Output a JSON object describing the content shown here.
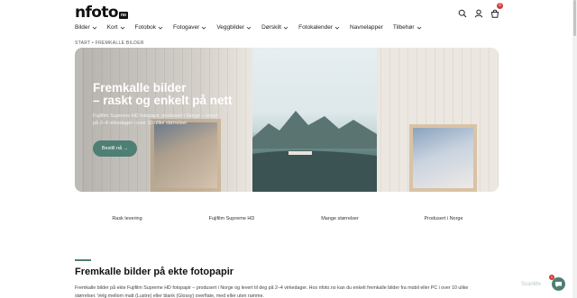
{
  "brand": {
    "logo_text": "nfoto",
    "logo_badge": "no"
  },
  "header": {
    "icons": [
      "search-icon",
      "user-icon",
      "cart-icon"
    ],
    "cart_count": "0"
  },
  "nav": {
    "items": [
      {
        "label": "Bilder",
        "has_dropdown": true
      },
      {
        "label": "Kort",
        "has_dropdown": true
      },
      {
        "label": "Fotobok",
        "has_dropdown": true
      },
      {
        "label": "Fotogaver",
        "has_dropdown": true
      },
      {
        "label": "Veggbilder",
        "has_dropdown": true
      },
      {
        "label": "Dørskilt",
        "has_dropdown": true
      },
      {
        "label": "Fotokalender",
        "has_dropdown": true
      },
      {
        "label": "Navnelapper",
        "has_dropdown": false
      },
      {
        "label": "Tilbehør",
        "has_dropdown": true
      }
    ]
  },
  "breadcrumb": "START • FREMKALLE BILDER",
  "hero": {
    "title": "Fremkalle bilder\n– raskt og enkelt på nett",
    "description": "Fujifilm Supreme HD fotopapir, produsert i Norge – levert på 2–4 virkedager i over 10 ulike størrelser",
    "button_label": "Bestill nå →"
  },
  "features": [
    "Rask levering",
    "Fujifilm Supreme HD",
    "Mange størrelser",
    "Produsert i Norge"
  ],
  "section": {
    "title": "Fremkalle bilder på ekte fotopapir",
    "text": "Fremkalle bilder på ekte Fujifilm Supreme HD fotopapir – produsert i Norge og levert til deg på 2–4 virkedager. Hos nfoto.no kan du enkelt fremkalle bilder fra mobil eller PC i over 10 ulike størrelser. Velg mellom matt (Lustre) eller blank (Glossy) overflate, med eller uten ramme."
  },
  "chat": {
    "badge": "1"
  },
  "watermark": "ScanMe",
  "colors": {
    "accent": "#4e7f74",
    "badge": "#d23a3a",
    "text": "#1e1e1e"
  }
}
